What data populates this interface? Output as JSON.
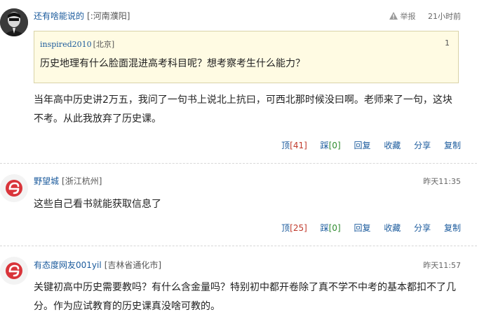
{
  "comments": [
    {
      "username": "还有啥能说的",
      "location": "[:河南濮阳]",
      "report_label": "举报",
      "time": "21小时前",
      "quote": {
        "username": "inspired2010",
        "location": "[北京]",
        "floor": "1",
        "text": "历史地理有什么脸面混进高考科目呢？想考察考生什么能力？"
      },
      "text_line1": "当年高中历史讲2万五，我问了一句书上说北上抗曰，可西北那时候没曰啊。老师来了一句，这块",
      "text_line2": "不考。从此我放弃了历史课。",
      "actions": {
        "up_label": "顶",
        "up_count": "[41]",
        "down_label": "踩",
        "down_count": "[0]",
        "reply": "回复",
        "favorite": "收藏",
        "share": "分享",
        "copy": "复制"
      }
    },
    {
      "username": "野望城",
      "location": "[浙江杭州]",
      "time": "昨天11:35",
      "text_line1": "这些自己看书就能获取信息了",
      "actions": {
        "up_label": "顶",
        "up_count": "[25]",
        "down_label": "踩",
        "down_count": "[0]",
        "reply": "回复",
        "favorite": "收藏",
        "share": "分享",
        "copy": "复制"
      }
    },
    {
      "username": "有态度网友001yil",
      "location": "[吉林省通化市]",
      "time": "昨天11:57",
      "text_line1": "关键初高中历史需要教吗？有什么含金量吗？特别初中都开卷除了真不学不中考的基本都扣不了几",
      "text_line2": "分。作为应试教育的历史课真没啥可教的。"
    }
  ],
  "icons": {
    "report": "warning-icon",
    "default_avatar": "netease-logo-icon"
  },
  "colors": {
    "link": "#1a5a9c",
    "up": "#c0392b",
    "down": "#2e8b2e",
    "quote_bg": "#fffbe3"
  }
}
